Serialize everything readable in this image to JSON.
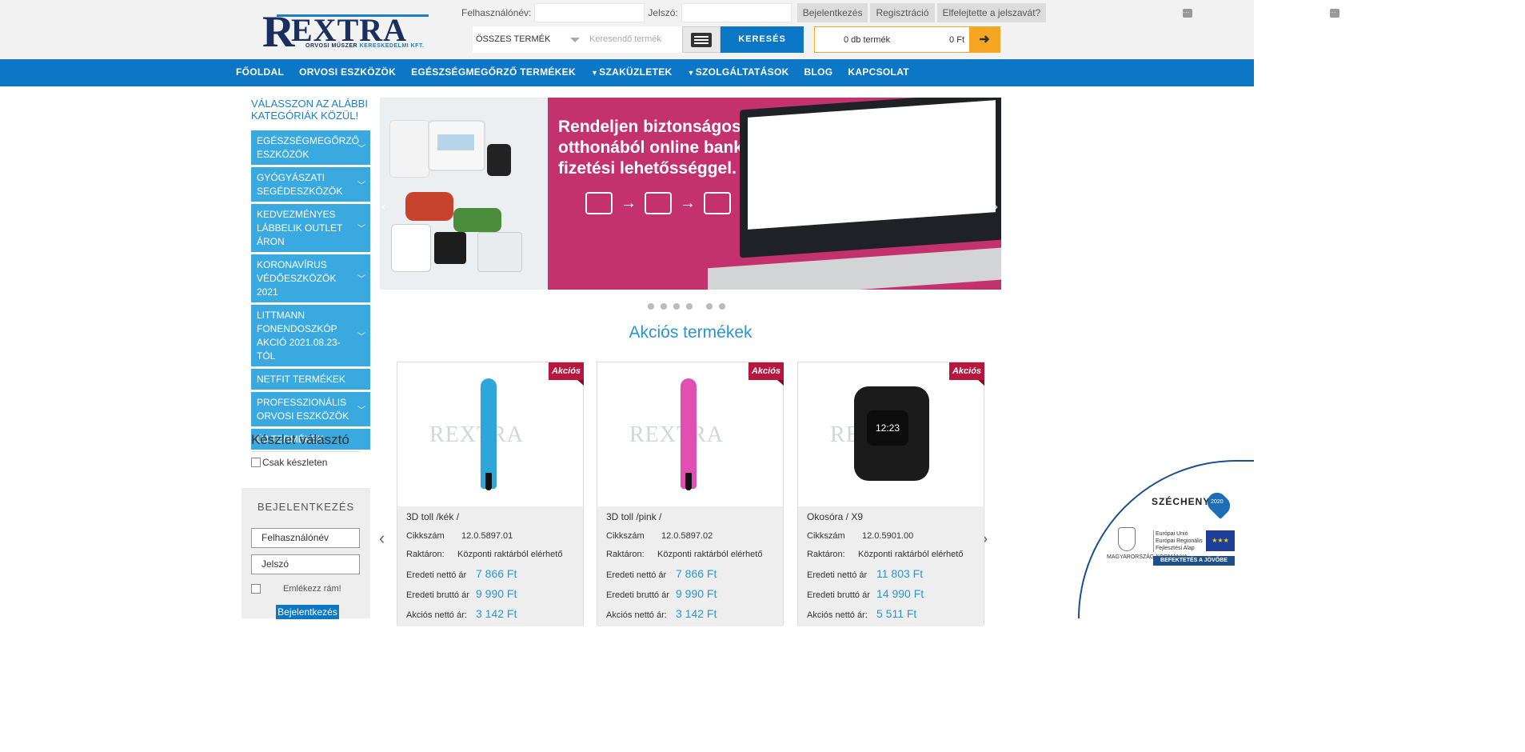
{
  "header": {
    "logo": {
      "r": "R",
      "name": "EXTRA",
      "sub_a": "ORVOSI MŰSZER",
      "sub_b": "KERESKEDELMI KFT."
    },
    "username_label": "Felhasználónév:",
    "password_label": "Jelszó:",
    "login_button": "Bejelentkezés",
    "register_button": "Regisztráció",
    "forgot_button": "Elfelejtette a jelszavát?",
    "category_select": "ÖSSZES TERMÉK",
    "search_placeholder": "Keresendő termék",
    "search_button": "KERESÉS",
    "cart_count": "0 db termék",
    "cart_total": "0 Ft",
    "cart_go": "➜"
  },
  "nav": {
    "items": [
      "FŐOLDAL",
      "ORVOSI ESZKÖZÖK",
      "EGÉSZSÉGMEGŐRZŐ TERMÉKEK",
      "SZAKÜZLETEK",
      "SZOLGÁLTATÁSOK",
      "BLOG",
      "KAPCSOLAT"
    ],
    "dropdown_icon": "chevron-down-icon"
  },
  "sidebar": {
    "title": "VÁLASSZON AZ ALÁBBI KATEGÓRIÁK KÖZÜL!",
    "categories": [
      "EGÉSZSÉGMEGŐRZŐ ESZKÖZÖK",
      "GYÓGYÁSZATI SEGÉDESZKÖZÖK",
      "KEDVEZMÉNYES LÁBBELIK OUTLET ÁRON",
      "KORONAVÍRUS VÉDŐESZKÖZÖK 2021",
      "LITTMANN FONENDOSZKÓP AKCIÓ 2021.08.23-TÓL",
      "NETFIT TERMÉKEK",
      "PROFESSZIONÁLIS ORVOSI ESZKÖZÖK",
      "ÚJ TERMÉKEK"
    ],
    "stock_title": "Készlet választó",
    "stock_option": "Csak készleten",
    "login_title": "BEJELENTKEZÉS",
    "login_username": "Felhasználónév",
    "login_password": "Jelszó",
    "remember": "Emlékezz rám!",
    "login_button": "Bejelentkezés"
  },
  "banner": {
    "headline": "Rendeljen biztonságosan otthonából online bankkártya fizetési lehetősséggel.",
    "prev": "‹",
    "next": "›"
  },
  "section": {
    "title": "Akciós termékek",
    "prev": "‹",
    "next": "›"
  },
  "products": [
    {
      "badge": "Akciós",
      "watermark": "REXTRA",
      "name": "3D toll /kék /",
      "sku_label": "Cikkszám",
      "sku": "12.0.5897.01",
      "stock_label": "Raktáron:",
      "stock": "Központi raktárból elérhető",
      "net_label": "Eredeti nettó ár",
      "net": "7 866 Ft",
      "gross_label": "Eredeti bruttó ár",
      "gross": "9 990 Ft",
      "sale_label": "Akciós nettó ár:",
      "sale": "3 142 Ft",
      "color": "#2ea6d9"
    },
    {
      "badge": "Akciós",
      "watermark": "REXTRA",
      "name": "3D toll /pink /",
      "sku_label": "Cikkszám",
      "sku": "12.0.5897.02",
      "stock_label": "Raktáron:",
      "stock": "Központi raktárból elérhető",
      "net_label": "Eredeti nettó ár",
      "net": "7 866 Ft",
      "gross_label": "Eredeti bruttó ár",
      "gross": "9 990 Ft",
      "sale_label": "Akciós nettó ár:",
      "sale": "3 142 Ft",
      "color": "#e04fb1"
    },
    {
      "badge": "Akciós",
      "watermark": "REXTRA",
      "name": "Okosóra / X9",
      "sku_label": "Cikkszám",
      "sku": "12.0.5901.00",
      "stock_label": "Raktáron:",
      "stock": "Központi raktárból elérhető",
      "net_label": "Eredeti nettó ár",
      "net": "11 803 Ft",
      "gross_label": "Eredeti bruttó ár",
      "gross": "14 990 Ft",
      "sale_label": "Akciós nettó ár:",
      "sale": "5 511 Ft",
      "watch_time": "12:23"
    }
  ],
  "szechenyi": {
    "title": "SZÉCHENYI",
    "pin": "2020",
    "gov": "MAGYARORSZÁG KORMÁNYA",
    "eu_lines": [
      "Európai Unió",
      "Európai Regionális",
      "Fejlesztési Alap"
    ],
    "flag": "★★★",
    "slogan": "BEFEKTETÉS A JÖVŐBE"
  }
}
